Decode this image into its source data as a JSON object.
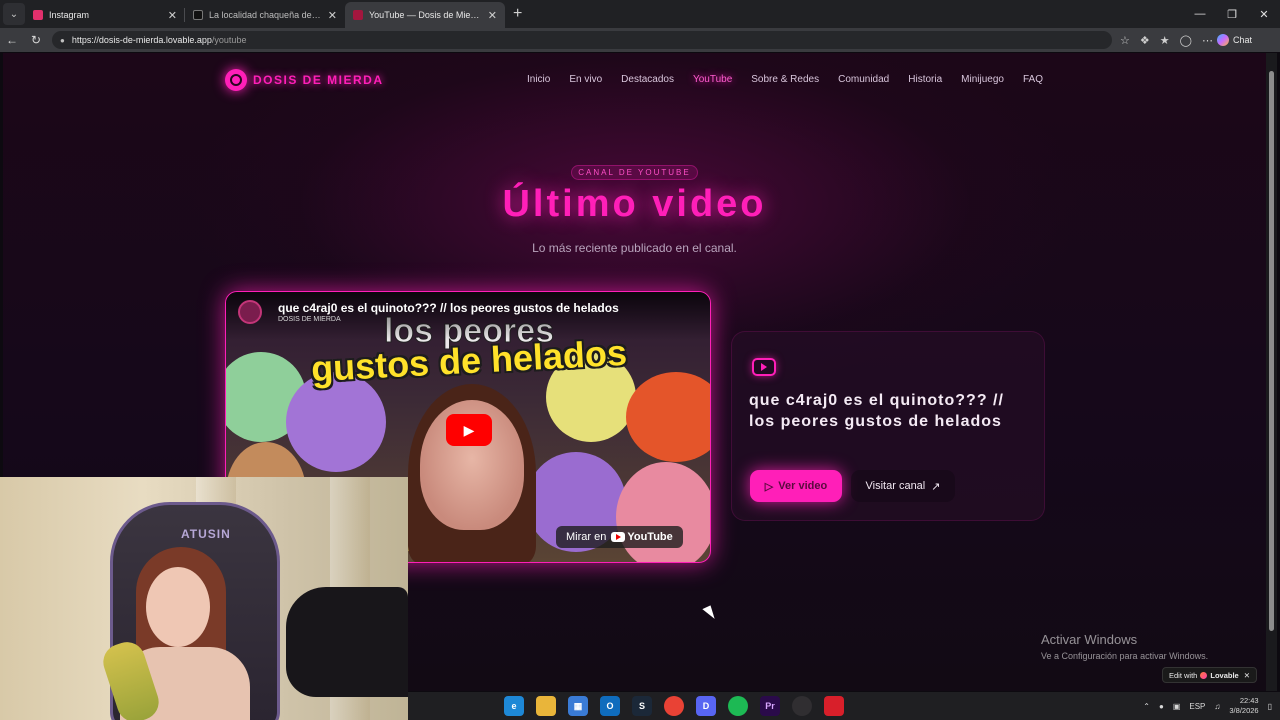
{
  "browser": {
    "tabs": [
      {
        "label": "Instagram",
        "active": false,
        "favicon_color": "#e1306c"
      },
      {
        "label": "La localidad chaqueña de Resistencia",
        "active": false,
        "favicon_color": "#000000"
      },
      {
        "label": "YouTube — Dosis de Mierda",
        "active": true,
        "favicon_color": "#a3163e"
      }
    ],
    "url_host": "https://dosis-de-mierda.lovable.app",
    "url_path": "/youtube",
    "chat_label": "Chat"
  },
  "site": {
    "brand": "DOSIS DE MIERDA",
    "nav": [
      "Inicio",
      "En vivo",
      "Destacados",
      "YouTube",
      "Sobre & Redes",
      "Comunidad",
      "Historia",
      "Minijuego",
      "FAQ"
    ],
    "nav_active": "YouTube",
    "kicker": "CANAL DE YOUTUBE",
    "title": "Último video",
    "subtitle": "Lo más reciente publicado en el canal.",
    "accent_color": "#ff1fb8"
  },
  "video": {
    "title": "que c4raj0 es el quinoto??? // los peores gustos de helados",
    "channel": "DOSIS DE MIERDA",
    "thumbnail_line1": "los peores",
    "thumbnail_line2": "gustos de helados",
    "watch_on": "Mirar en",
    "youtube_word": "YouTube"
  },
  "card": {
    "title": "que c4raj0 es el quinoto??? // los peores gustos de helados",
    "watch_button": "Ver video",
    "channel_button": "Visitar canal"
  },
  "webcam": {
    "chair_label": "ATUSIN"
  },
  "windows": {
    "activate_title": "Activar Windows",
    "activate_sub": "Ve a Configuración para activar Windows.",
    "lovable_prefix": "Edit with",
    "lovable_brand": "Lovable",
    "lang": "ESP",
    "time": "22:43",
    "date": "3/8/2026"
  }
}
